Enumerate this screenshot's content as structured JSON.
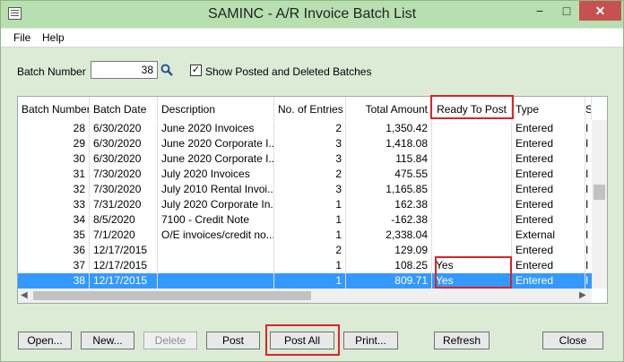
{
  "window": {
    "title": "SAMINC - A/R Invoice Batch List",
    "minimize": "−",
    "maximize": "□",
    "close": "✕"
  },
  "menu": {
    "file": "File",
    "help": "Help"
  },
  "filter": {
    "batch_label": "Batch Number",
    "batch_value": "38",
    "show_posted_label": "Show Posted and Deleted Batches",
    "show_posted_checked": "✓"
  },
  "grid": {
    "columns": [
      "Batch Number",
      "Batch Date",
      "Description",
      "No. of Entries",
      "Total Amount",
      "Ready To Post",
      "Type",
      "S"
    ],
    "rows": [
      {
        "batch": "28",
        "date": "6/30/2020",
        "desc": "June 2020 Invoices",
        "entries": "2",
        "total": "1,350.42",
        "ready": "",
        "type": "Entered",
        "s": "I"
      },
      {
        "batch": "29",
        "date": "6/30/2020",
        "desc": "June 2020 Corporate I...",
        "entries": "3",
        "total": "1,418.08",
        "ready": "",
        "type": "Entered",
        "s": "I"
      },
      {
        "batch": "30",
        "date": "6/30/2020",
        "desc": "June 2020 Corporate I...",
        "entries": "3",
        "total": "115.84",
        "ready": "",
        "type": "Entered",
        "s": "I"
      },
      {
        "batch": "31",
        "date": "7/30/2020",
        "desc": "July 2020 Invoices",
        "entries": "2",
        "total": "475.55",
        "ready": "",
        "type": "Entered",
        "s": "I"
      },
      {
        "batch": "32",
        "date": "7/30/2020",
        "desc": "July 2010 Rental Invoi...",
        "entries": "3",
        "total": "1,165.85",
        "ready": "",
        "type": "Entered",
        "s": "I"
      },
      {
        "batch": "33",
        "date": "7/31/2020",
        "desc": "July 2020 Corporate In...",
        "entries": "1",
        "total": "162.38",
        "ready": "",
        "type": "Entered",
        "s": "I"
      },
      {
        "batch": "34",
        "date": "8/5/2020",
        "desc": "7100 - Credit Note",
        "entries": "1",
        "total": "-162.38",
        "ready": "",
        "type": "Entered",
        "s": "I"
      },
      {
        "batch": "35",
        "date": "7/1/2020",
        "desc": "O/E invoices/credit no...",
        "entries": "1",
        "total": "2,338.04",
        "ready": "",
        "type": "External",
        "s": "I"
      },
      {
        "batch": "36",
        "date": "12/17/2015",
        "desc": "",
        "entries": "2",
        "total": "129.09",
        "ready": "",
        "type": "Entered",
        "s": "I"
      },
      {
        "batch": "37",
        "date": "12/17/2015",
        "desc": "",
        "entries": "1",
        "total": "108.25",
        "ready": "Yes",
        "type": "Entered",
        "s": "I"
      },
      {
        "batch": "38",
        "date": "12/17/2015",
        "desc": "",
        "entries": "1",
        "total": "809.71",
        "ready": "Yes",
        "type": "Entered",
        "s": "I"
      }
    ]
  },
  "buttons": {
    "open": "Open...",
    "new": "New...",
    "delete": "Delete",
    "post": "Post",
    "post_all": "Post All",
    "print": "Print...",
    "refresh": "Refresh",
    "close": "Close"
  },
  "colors": {
    "selection": "#3399ff",
    "highlight": "#d9232b",
    "titlebar": "#b7dfb0"
  }
}
